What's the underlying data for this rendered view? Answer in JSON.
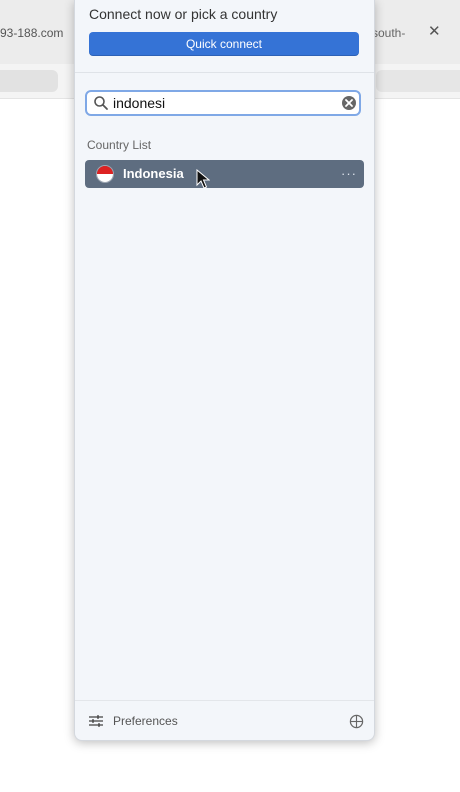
{
  "browser": {
    "tab_left_text": "93-188.com",
    "tab_right_text": "south-",
    "close_glyph": "✕"
  },
  "panel": {
    "connect_title": "Connect now or pick a country",
    "quick_connect_label": "Quick connect",
    "search": {
      "value": "indonesi",
      "placeholder": "",
      "icon": "search-icon",
      "clear_icon": "clear-icon"
    },
    "list_heading": "Country List",
    "countries": [
      {
        "name": "Indonesia",
        "flag_colors": [
          "#dd2222",
          "#ffffff"
        ],
        "selected": true,
        "more_glyph": "···"
      }
    ],
    "footer": {
      "preferences_label": "Preferences",
      "preferences_icon": "sliders-icon",
      "globe_icon": "globe-icon"
    }
  },
  "colors": {
    "accent": "#3573d6",
    "selected_row": "#5e6d80",
    "panel_bg": "#f3f6fa"
  }
}
